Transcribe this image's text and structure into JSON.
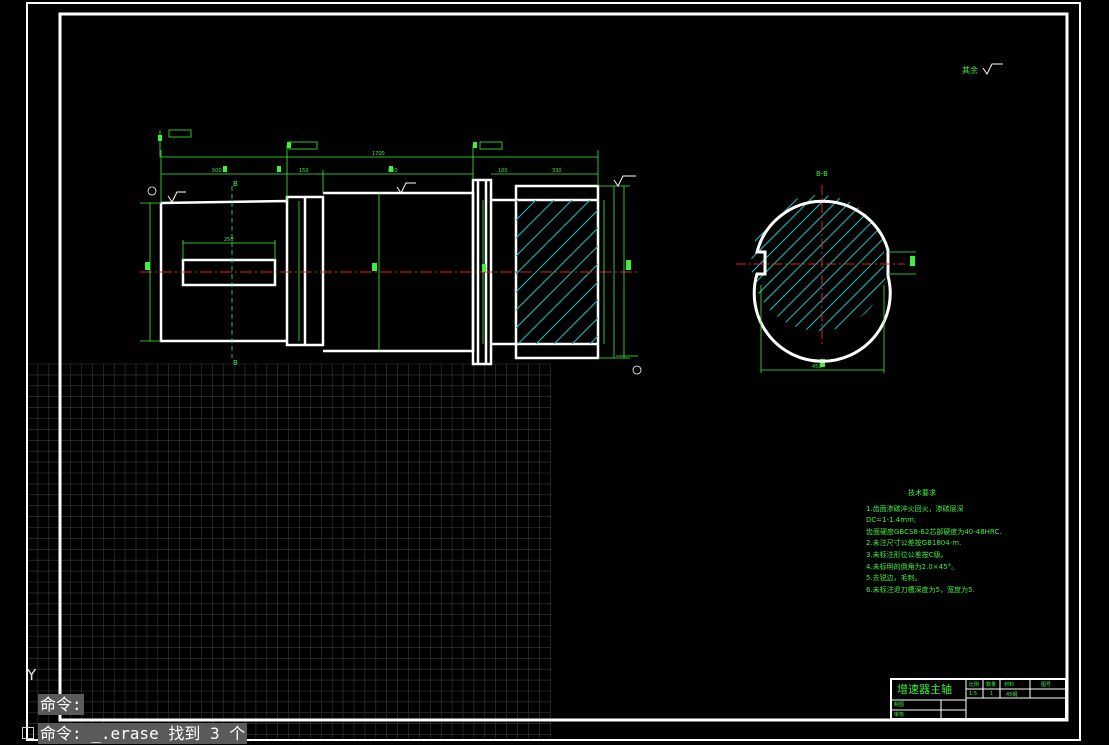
{
  "drawing": {
    "section_label": "B-B",
    "cut_label_top": "B",
    "cut_label_bottom": "B",
    "roughness_note": "其余",
    "tech_requirements": {
      "title": "技术要求",
      "items": [
        "1.齿面渗碳淬火回火，渗碳层深",
        "DC=1-1.4mm,",
        "齿面硬度GBCS8-62芯部硬度为40-48HRC.",
        "2.未注尺寸公差按GB1804-m.",
        "3.未标注形位公差按C级。",
        "4.未标明的倒角为2.0×45°。",
        "5.去锐边，毛刺。",
        "6.未标注退刀槽深度为5，宽度为5."
      ]
    },
    "title_block": {
      "part_name": "增速器主轴",
      "drawn_by": "制图",
      "checked_by": "审核",
      "col_scale": "比例",
      "col_qty": "数量",
      "col_material": "材料",
      "col_drawing_no": "图号",
      "scale": "1:5",
      "qty": "1",
      "material": "45钢"
    }
  },
  "command": {
    "prompt": "命令:",
    "last_command": "命令: _.erase 找到 3 个"
  },
  "ucs": {
    "y_axis_label": "Y"
  },
  "colors": {
    "background": "#000000",
    "border": "#ffffff",
    "dimension": "#3cf03c",
    "centerline": "#e02020",
    "hatch": "#20c0c0",
    "grid": "#3a3a3a",
    "command_bg": "#5a5a5a"
  }
}
